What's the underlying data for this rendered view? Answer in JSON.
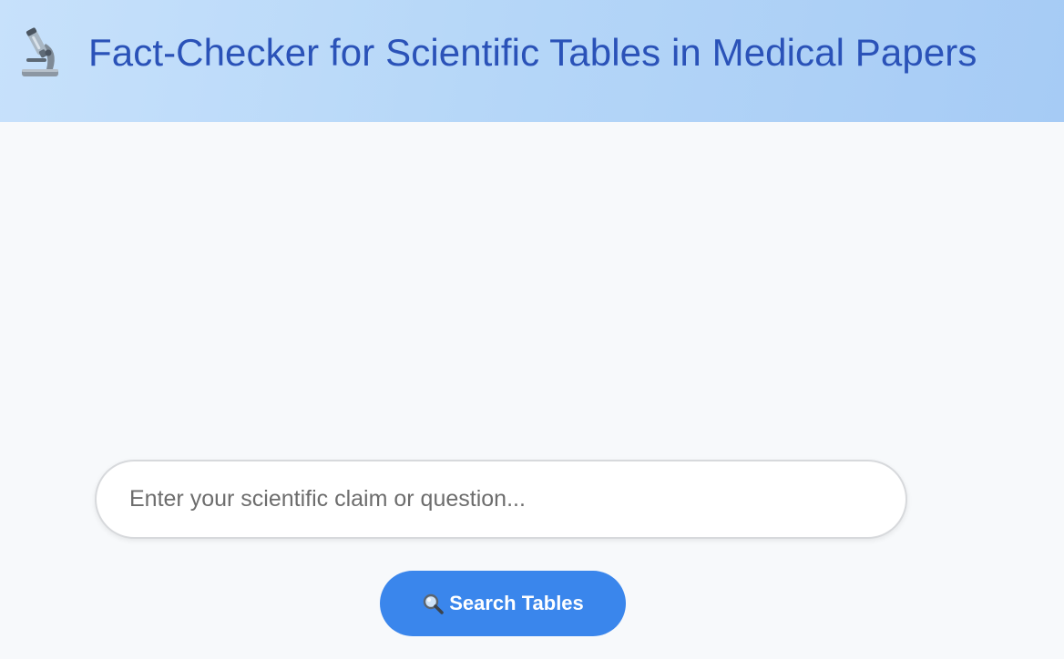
{
  "header": {
    "logo_icon": "microscope-icon",
    "title": "Fact-Checker for Scientific Tables in Medical Papers"
  },
  "search": {
    "placeholder": "Enter your scientific claim or question...",
    "value": "",
    "button_icon": "magnifier-icon",
    "button_label": "Search Tables"
  },
  "colors": {
    "header_gradient_start": "#c7e1fb",
    "header_gradient_end": "#a6cbf5",
    "title_text": "#2a52b8",
    "button_background": "#3a86ec",
    "page_background": "#f7f9fb"
  }
}
